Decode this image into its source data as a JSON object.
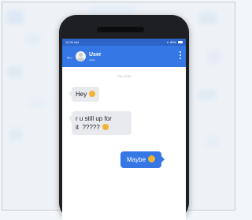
{
  "status_bar": {
    "time": "10:30 AM",
    "battery": "85%"
  },
  "header": {
    "name": "User",
    "presence": "online"
  },
  "chat": {
    "timestamp": "Thu 12:00",
    "messages": [
      {
        "direction": "incoming",
        "text_lines": [
          "Hey"
        ],
        "emoji": "grinning-face"
      },
      {
        "direction": "incoming",
        "text_lines": [
          "r u still up for",
          "it  ?????"
        ],
        "emoji": "grinning-face"
      },
      {
        "direction": "outgoing",
        "text_lines": [
          "Maybe"
        ],
        "emoji": "thinking-face"
      }
    ]
  },
  "colors": {
    "header": "#3578e5",
    "status_bar": "#2c64c8",
    "outgoing_bubble": "#3578e5",
    "incoming_bubble": "#e8eaed"
  }
}
